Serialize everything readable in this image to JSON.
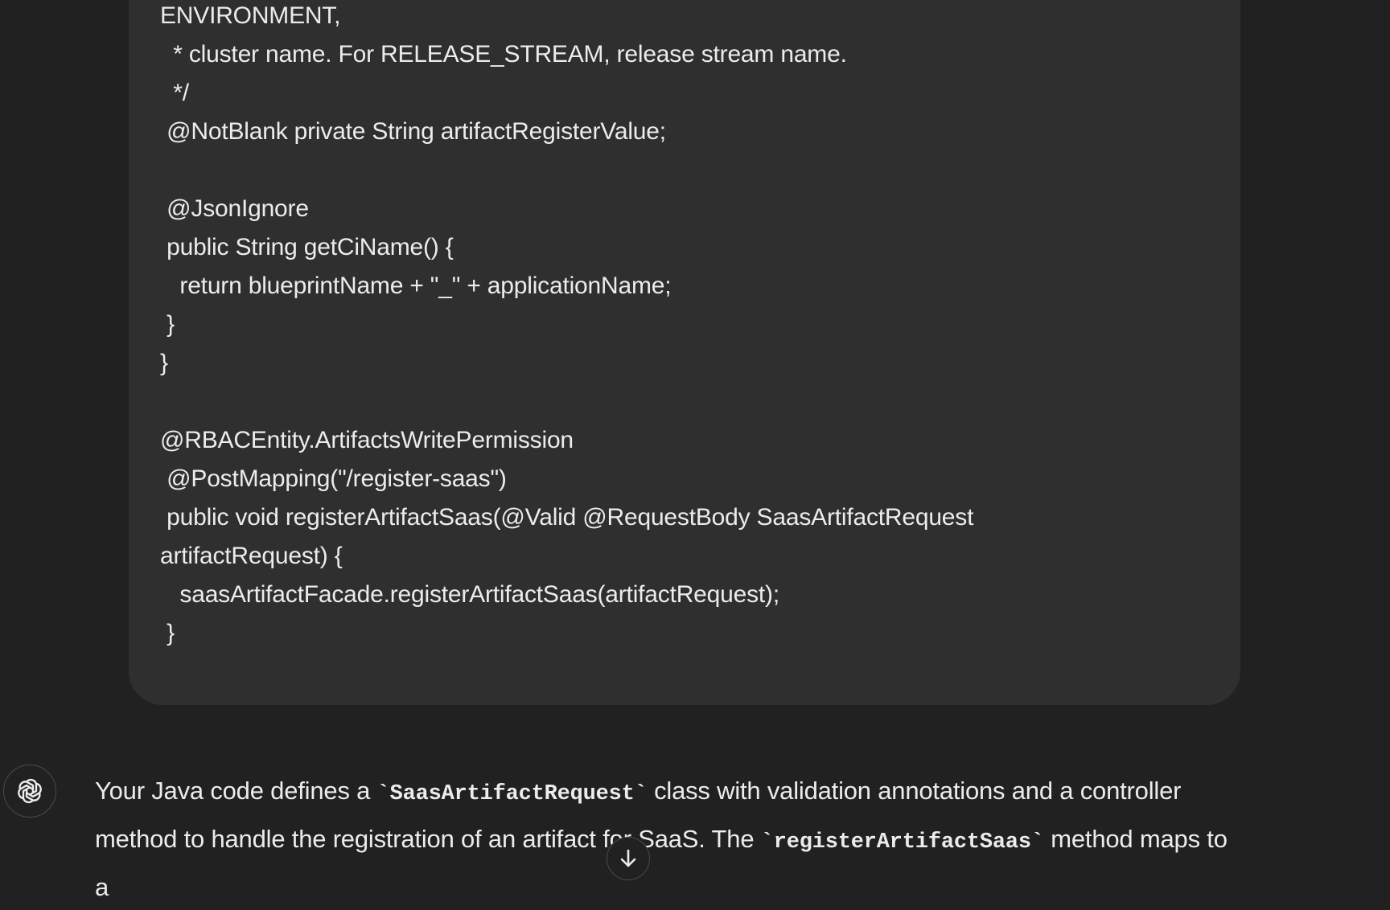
{
  "user_message": {
    "code_lines": [
      "ENVIRONMENT,",
      "  * cluster name. For RELEASE_STREAM, release stream name.",
      "  */",
      " @NotBlank private String artifactRegisterValue;",
      "",
      " @JsonIgnore",
      " public String getCiName() {",
      "   return blueprintName + \"_\" + applicationName;",
      " }",
      "}",
      "",
      "@RBACEntity.ArtifactsWritePermission",
      " @PostMapping(\"/register-saas\")",
      " public void registerArtifactSaas(@Valid @RequestBody SaasArtifactRequest",
      "artifactRequest) {",
      "   saasArtifactFacade.registerArtifactSaas(artifactRequest);",
      " }"
    ]
  },
  "assistant_message": {
    "avatar_icon": "openai-logo-icon",
    "text_1": "Your Java code defines a ",
    "code_1": "`SaasArtifactRequest`",
    "text_2": " class with validation annotations and a controller method to handle the registration of an artifact for SaaS. The ",
    "code_2": "`registerArtifactSaas`",
    "text_3": " method maps to a"
  },
  "scroll_button": {
    "icon": "arrow-down-icon"
  },
  "colors": {
    "background": "#212121",
    "bubble": "#2f2f2f",
    "text": "#ececec",
    "border": "#4a4a4a"
  }
}
